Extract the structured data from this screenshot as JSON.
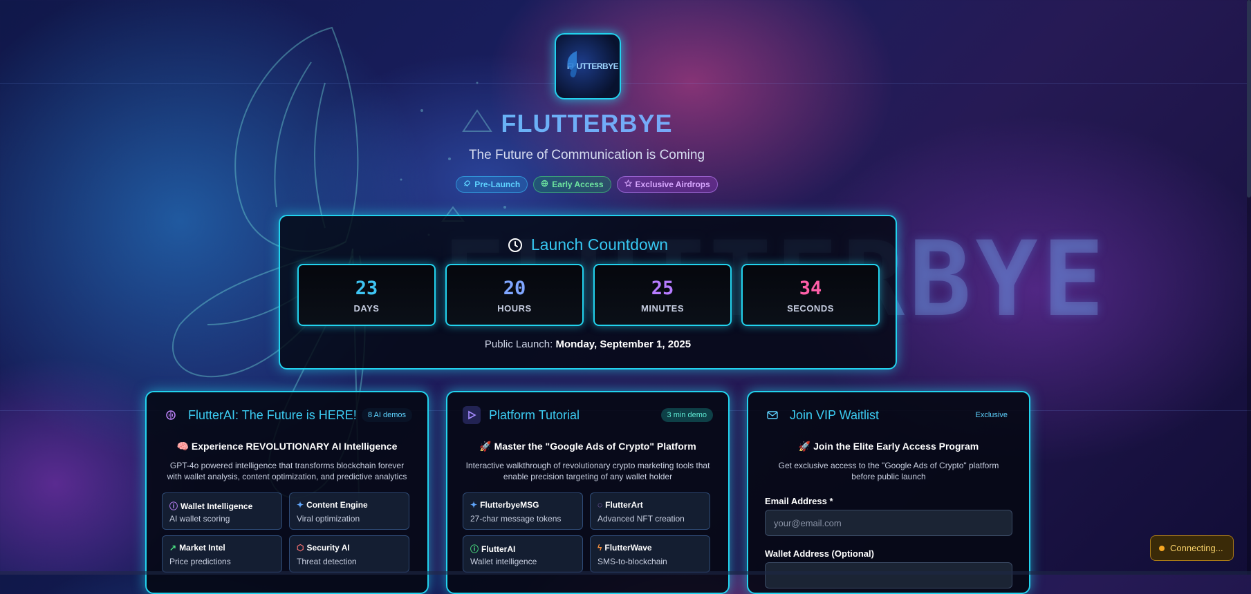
{
  "brand": {
    "name": "FLUTTERBYE",
    "logo_text": "FLUTTERBYE",
    "tagline": "The Future of Communication is Coming"
  },
  "badges": [
    {
      "label": "Pre-Launch",
      "icon": "rocket-icon"
    },
    {
      "label": "Early Access",
      "icon": "globe-icon"
    },
    {
      "label": "Exclusive Airdrops",
      "icon": "star-icon"
    }
  ],
  "countdown": {
    "title": "Launch Countdown",
    "units": [
      {
        "value": "23",
        "label": "DAYS",
        "color": "#3ec5f3"
      },
      {
        "value": "20",
        "label": "HOURS",
        "color": "#7fa6ff"
      },
      {
        "value": "25",
        "label": "MINUTES",
        "color": "#b77cff"
      },
      {
        "value": "34",
        "label": "SECONDS",
        "color": "#ff5fa8"
      }
    ],
    "launch_prefix": "Public Launch:",
    "launch_date": "Monday, September 1, 2025"
  },
  "cards": {
    "ai": {
      "title": "FlutterAI: The Future is HERE!",
      "pill": "8 AI demos",
      "subtitle": "🧠 Experience REVOLUTIONARY AI Intelligence",
      "description": "GPT-4o powered intelligence that transforms blockchain forever with wallet analysis, content optimization, and predictive analytics",
      "features": [
        {
          "title": "Wallet Intelligence",
          "desc": "AI wallet scoring",
          "icon": "brain-icon",
          "icon_color": "#c084fc"
        },
        {
          "title": "Content Engine",
          "desc": "Viral optimization",
          "icon": "sparkle-icon",
          "icon_color": "#60a5fa"
        },
        {
          "title": "Market Intel",
          "desc": "Price predictions",
          "icon": "trend-icon",
          "icon_color": "#4ade80"
        },
        {
          "title": "Security AI",
          "desc": "Threat detection",
          "icon": "shield-icon",
          "icon_color": "#f87171"
        }
      ]
    },
    "tutorial": {
      "title": "Platform Tutorial",
      "pill": "3 min demo",
      "subtitle": "🚀 Master the \"Google Ads of Crypto\" Platform",
      "description": "Interactive walkthrough of revolutionary crypto marketing tools that enable precision targeting of any wallet holder",
      "features": [
        {
          "title": "FlutterbyeMSG",
          "desc": "27-char message tokens",
          "icon": "sparkle-icon",
          "icon_color": "#60a5fa"
        },
        {
          "title": "FlutterArt",
          "desc": "Advanced NFT creation",
          "icon": "palette-icon",
          "icon_color": "#c084fc"
        },
        {
          "title": "FlutterAI",
          "desc": "Wallet intelligence",
          "icon": "brain-icon",
          "icon_color": "#4ade80"
        },
        {
          "title": "FlutterWave",
          "desc": "SMS-to-blockchain",
          "icon": "bolt-icon",
          "icon_color": "#fb923c"
        }
      ]
    },
    "waitlist": {
      "title": "Join VIP Waitlist",
      "pill": "Exclusive",
      "subtitle": "🚀 Join the Elite Early Access Program",
      "description": "Get exclusive access to the \"Google Ads of Crypto\" platform before public launch",
      "email_label": "Email Address *",
      "email_placeholder": "your@email.com",
      "wallet_label": "Wallet Address (Optional)"
    }
  },
  "status": {
    "label": "Connecting..."
  },
  "background_text": "FLUTTERBYE"
}
